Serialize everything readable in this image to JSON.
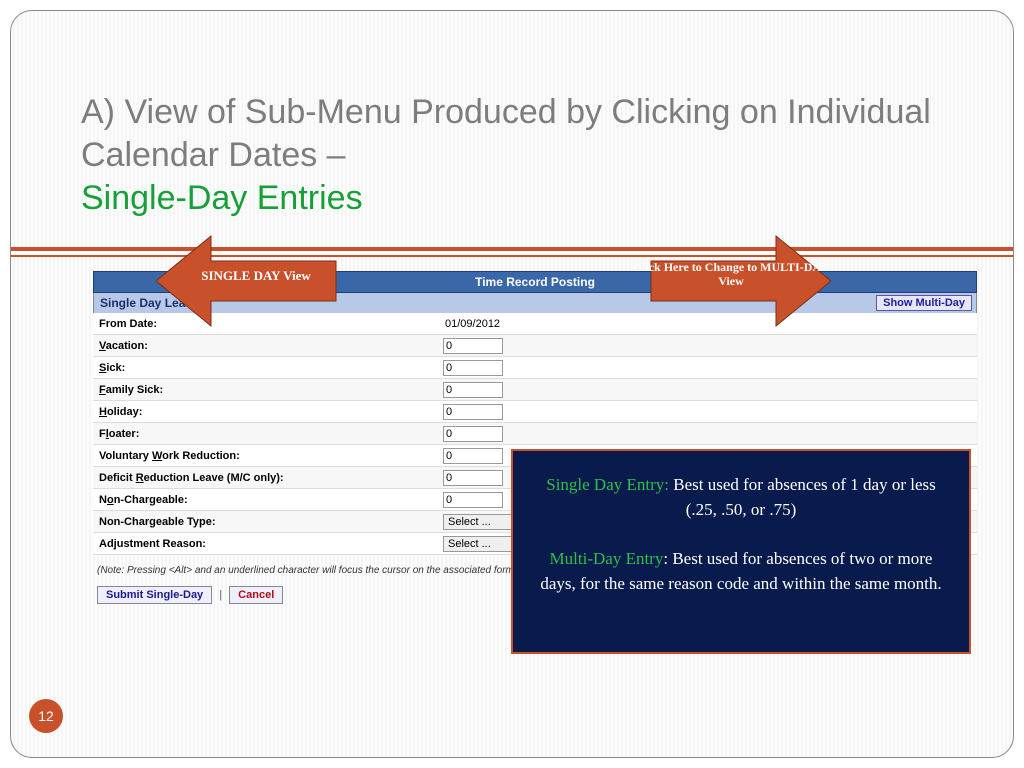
{
  "title": {
    "line1": "A) View of Sub-Menu Produced by Clicking on Individual Calendar Dates –",
    "line2": "Single-Day Entries"
  },
  "arrows": {
    "left_text": "SINGLE DAY View",
    "right_text": "Click Here to Change to MULTI-DAY View"
  },
  "form": {
    "header": "Time Record Posting",
    "sub_header": "Single Day Leave",
    "show_multi_btn": "Show Multi-Day",
    "rows": [
      {
        "label_html": "From Date:",
        "type": "date",
        "value": "01/09/2012"
      },
      {
        "label_html": "<u>V</u>acation:",
        "type": "num",
        "value": "0"
      },
      {
        "label_html": "<u>S</u>ick:",
        "type": "num",
        "value": "0"
      },
      {
        "label_html": "<u>F</u>amily Sick:",
        "type": "num",
        "value": "0"
      },
      {
        "label_html": "<u>H</u>oliday:",
        "type": "num",
        "value": "0"
      },
      {
        "label_html": "F<u>l</u>oater:",
        "type": "num",
        "value": "0"
      },
      {
        "label_html": "Voluntary <u>W</u>ork Reduction:",
        "type": "num",
        "value": "0"
      },
      {
        "label_html": "Deficit <u>R</u>eduction Leave (M/C only):",
        "type": "num",
        "value": "0"
      },
      {
        "label_html": "N<u>o</u>n-Chargeable:",
        "type": "num",
        "value": "0"
      },
      {
        "label_html": "Non-Chargeable Type:",
        "type": "select",
        "value": "Select ..."
      },
      {
        "label_html": "Adjustment Reason:",
        "type": "select",
        "value": "Select ..."
      }
    ],
    "note": "(Note: Pressing <Alt> and an underlined character will focus the cursor on the associated form field.)",
    "submit_btn": "Submit Single-Day",
    "cancel_btn": "Cancel"
  },
  "infobox": {
    "p1_label": "Single Day Entry:",
    "p1_text": " Best used for absences of 1 day or less (.25, .50, or .75)",
    "p2_label": "Multi-Day Entry",
    "p2_text": ": Best used for absences of two or more days, for the same reason code and within the same month."
  },
  "page_number": "12"
}
